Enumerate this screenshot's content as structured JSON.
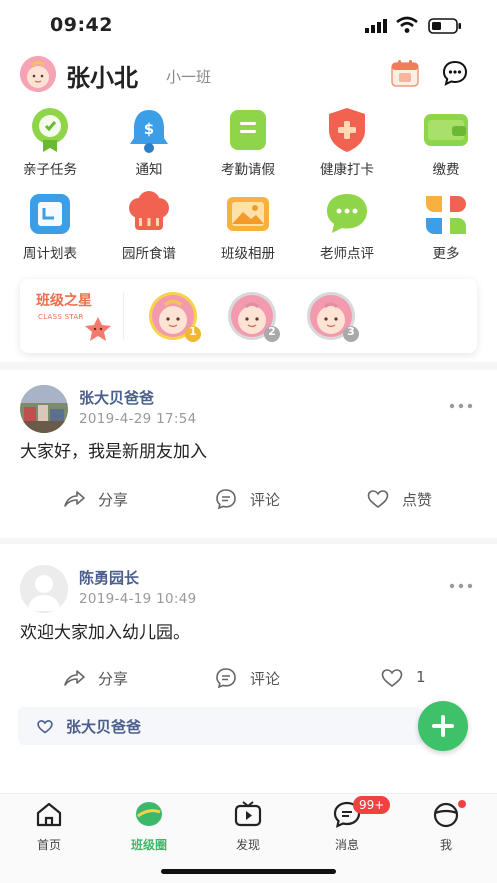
{
  "status_bar": {
    "time": "09:42"
  },
  "header": {
    "user_name": "张小北",
    "class_name": "小一班"
  },
  "grid": [
    {
      "label": "亲子任务",
      "icon": "parent-task-icon"
    },
    {
      "label": "通知",
      "icon": "notice-bell-icon"
    },
    {
      "label": "考勤请假",
      "icon": "attendance-icon"
    },
    {
      "label": "健康打卡",
      "icon": "health-shield-icon"
    },
    {
      "label": "缴费",
      "icon": "wallet-icon"
    },
    {
      "label": "周计划表",
      "icon": "weekly-plan-icon"
    },
    {
      "label": "园所食谱",
      "icon": "chef-hat-icon"
    },
    {
      "label": "班级相册",
      "icon": "photo-album-icon"
    },
    {
      "label": "老师点评",
      "icon": "comment-bubble-icon"
    },
    {
      "label": "更多",
      "icon": "more-apps-icon"
    }
  ],
  "class_star": {
    "title": "班级之星",
    "subtitle": "CLASS STAR",
    "ranks": [
      "1",
      "2",
      "3"
    ]
  },
  "posts": [
    {
      "author": "张大贝爸爸",
      "date": "2019-4-29 17:54",
      "text": "大家好，我是新朋友加入",
      "actions": {
        "share": "分享",
        "comment": "评论",
        "like": "点赞"
      }
    },
    {
      "author": "陈勇园长",
      "date": "2019-4-19 10:49",
      "text": "欢迎大家加入幼儿园。",
      "actions": {
        "share": "分享",
        "comment": "评论",
        "like": "1"
      },
      "liked_by": "张大贝爸爸"
    }
  ],
  "tabbar": {
    "items": [
      {
        "label": "首页",
        "icon": "home-icon"
      },
      {
        "label": "班级圈",
        "icon": "class-circle-icon"
      },
      {
        "label": "发现",
        "icon": "discover-tv-icon"
      },
      {
        "label": "消息",
        "icon": "message-icon"
      },
      {
        "label": "我",
        "icon": "profile-icon"
      }
    ],
    "message_badge": "99+"
  },
  "colors": {
    "accent_green": "#3db86a",
    "link_blue": "#4b5e8c",
    "badge_red": "#f0433f"
  }
}
